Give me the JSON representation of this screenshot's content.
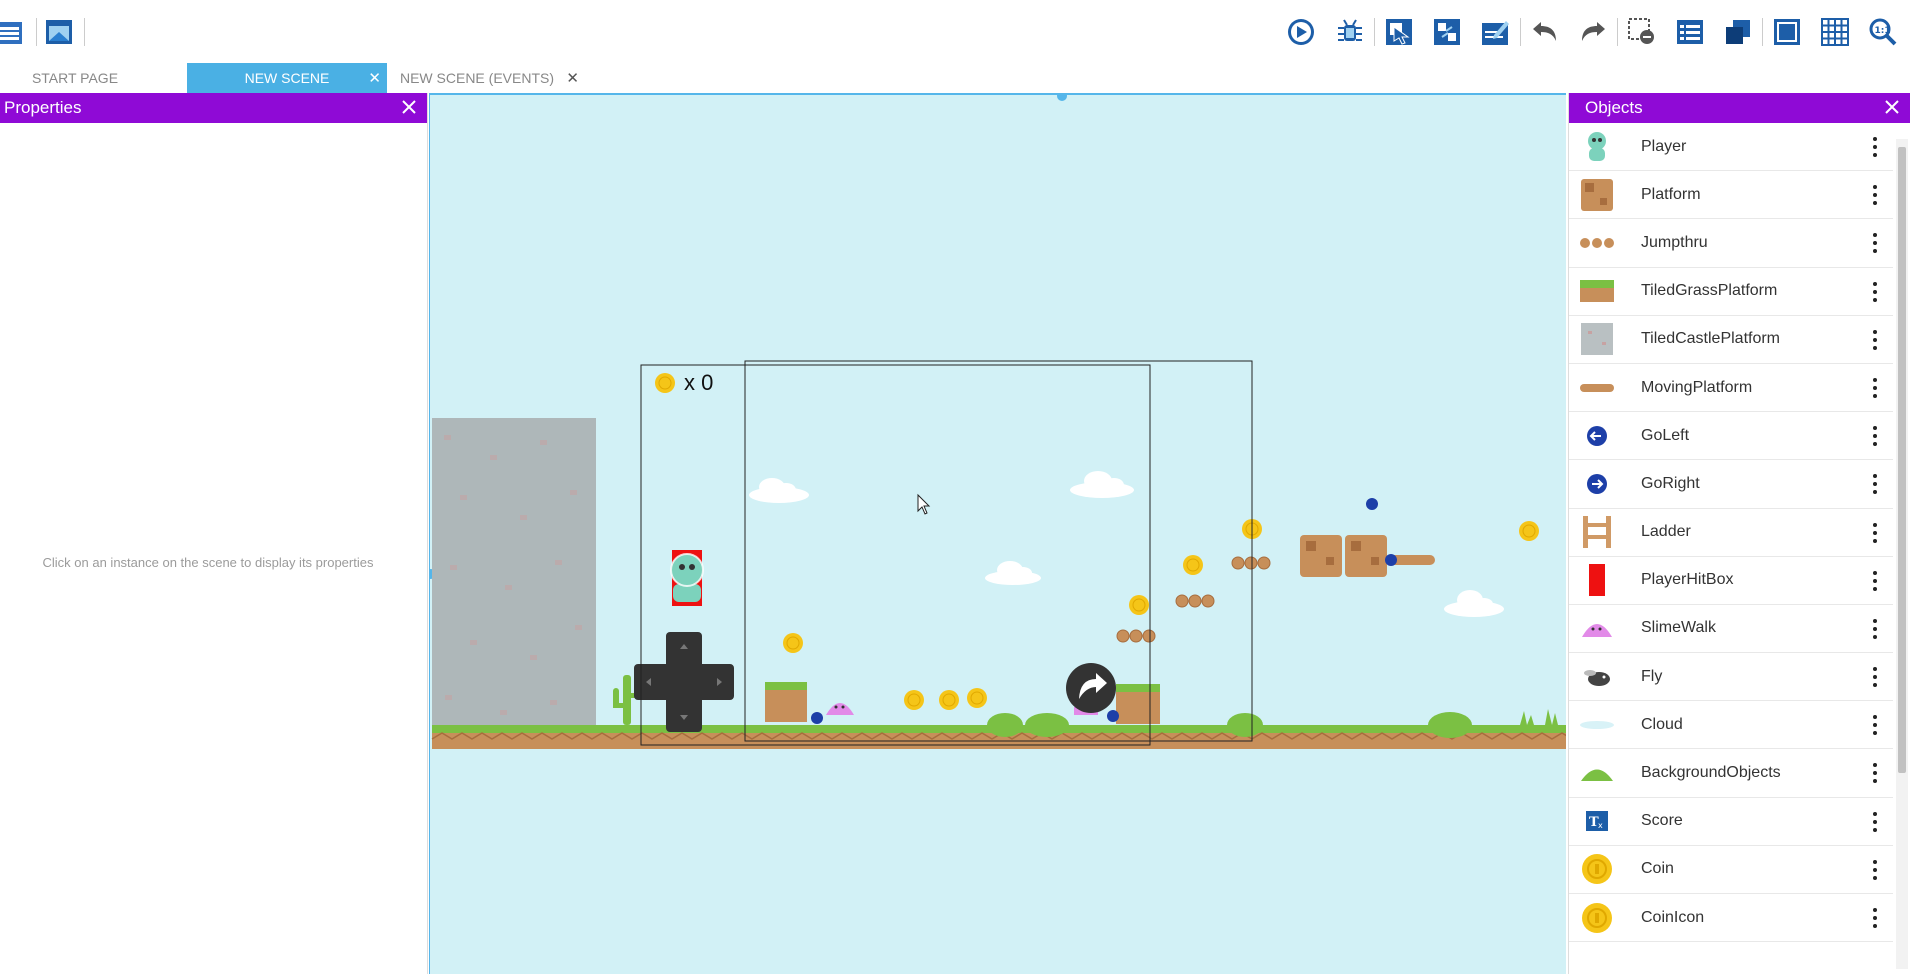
{
  "tabs": [
    {
      "label": "START PAGE",
      "closable": false,
      "active": false
    },
    {
      "label": "NEW SCENE",
      "closable": true,
      "active": true
    },
    {
      "label": "NEW SCENE (EVENTS)",
      "closable": true,
      "active": false
    }
  ],
  "properties": {
    "title": "Properties",
    "hint": "Click on an instance on the scene to display its properties"
  },
  "objects": {
    "title": "Objects",
    "items": [
      {
        "name": "Player",
        "icon": "player-icon"
      },
      {
        "name": "Platform",
        "icon": "platform-icon"
      },
      {
        "name": "Jumpthru",
        "icon": "jumpthru-icon"
      },
      {
        "name": "TiledGrassPlatform",
        "icon": "grass-platform-icon"
      },
      {
        "name": "TiledCastlePlatform",
        "icon": "castle-platform-icon"
      },
      {
        "name": "MovingPlatform",
        "icon": "moving-platform-icon"
      },
      {
        "name": "GoLeft",
        "icon": "go-left-icon"
      },
      {
        "name": "GoRight",
        "icon": "go-right-icon"
      },
      {
        "name": "Ladder",
        "icon": "ladder-icon"
      },
      {
        "name": "PlayerHitBox",
        "icon": "hitbox-icon"
      },
      {
        "name": "SlimeWalk",
        "icon": "slime-icon"
      },
      {
        "name": "Fly",
        "icon": "fly-icon"
      },
      {
        "name": "Cloud",
        "icon": "cloud-icon"
      },
      {
        "name": "BackgroundObjects",
        "icon": "bush-icon"
      },
      {
        "name": "Score",
        "icon": "text-icon"
      },
      {
        "name": "Coin",
        "icon": "coin-icon"
      },
      {
        "name": "CoinIcon",
        "icon": "coin-icon"
      }
    ]
  },
  "scene": {
    "score_text": "x 0"
  },
  "colors": {
    "accent": "#8f0ad6",
    "tab_active": "#4ab0e4",
    "scene_bg": "#d2f1f6",
    "grass": "#7bc043",
    "dirt": "#c78f5a",
    "coin": "#f5c518"
  }
}
